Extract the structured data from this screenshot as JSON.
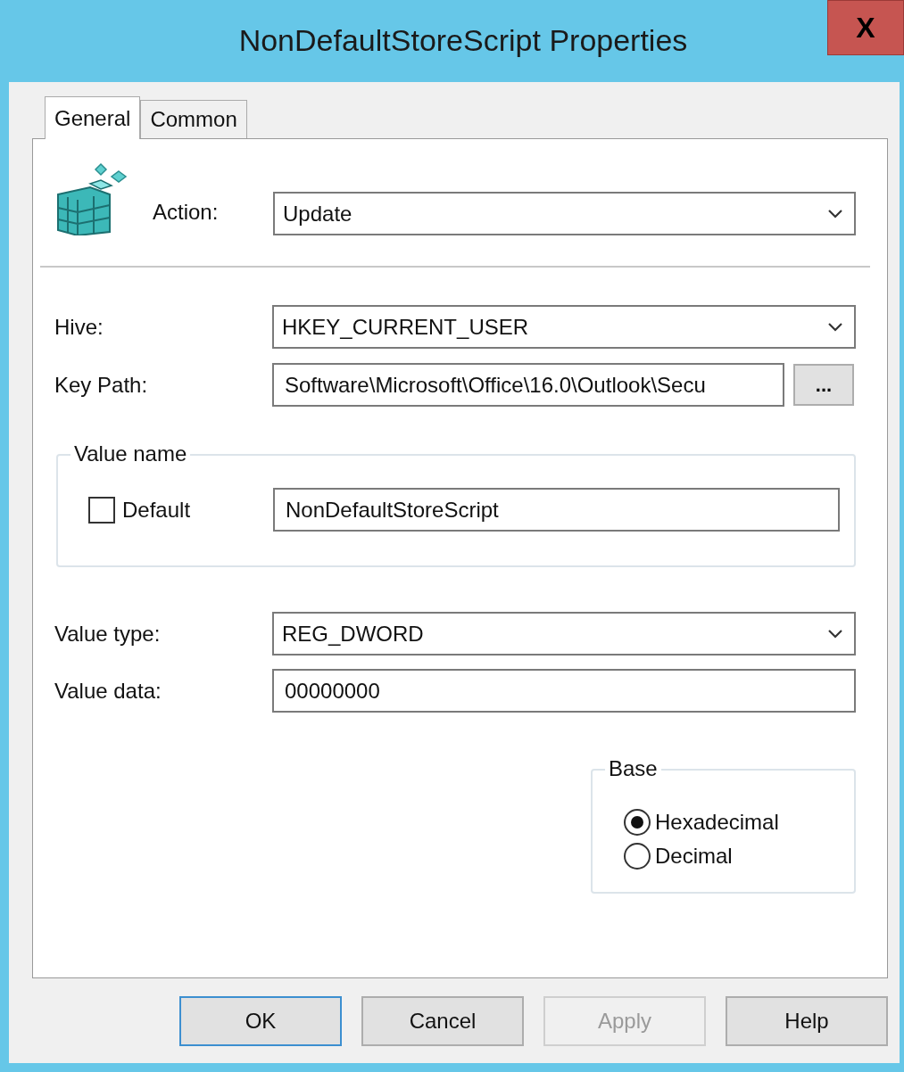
{
  "window": {
    "title": "NonDefaultStoreScript Properties",
    "close": "X"
  },
  "tabs": [
    {
      "label": "General",
      "selected": true
    },
    {
      "label": "Common",
      "selected": false
    }
  ],
  "action": {
    "label": "Action:",
    "value": "Update"
  },
  "hive": {
    "label": "Hive:",
    "value": "HKEY_CURRENT_USER"
  },
  "key_path": {
    "label": "Key Path:",
    "value": "Software\\Microsoft\\Office\\16.0\\Outlook\\Secu",
    "browse": "..."
  },
  "value_name": {
    "legend": "Value name",
    "checkbox": {
      "label": "Default",
      "checked": false
    },
    "value": "NonDefaultStoreScript"
  },
  "value_type": {
    "label": "Value type:",
    "value": "REG_DWORD"
  },
  "value_data": {
    "label": "Value data:",
    "value": "00000000"
  },
  "base": {
    "legend": "Base",
    "options": [
      {
        "label": "Hexadecimal",
        "selected": true
      },
      {
        "label": "Decimal",
        "selected": false
      }
    ]
  },
  "buttons": [
    {
      "label": "OK",
      "default": true,
      "disabled": false
    },
    {
      "label": "Cancel",
      "default": false,
      "disabled": false
    },
    {
      "label": "Apply",
      "default": false,
      "disabled": true
    },
    {
      "label": "Help",
      "default": false,
      "disabled": false
    }
  ]
}
